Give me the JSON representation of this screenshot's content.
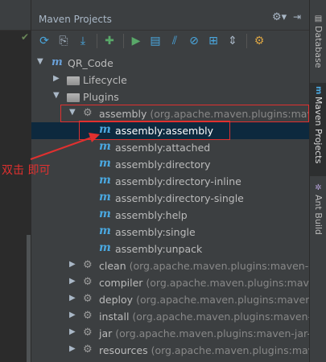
{
  "panel": {
    "title": "Maven Projects"
  },
  "header_icons": {
    "settings": "gear-icon",
    "hide": "hide-panel-icon"
  },
  "toolbar": {
    "buttons": [
      "refresh-icon",
      "reimport-icon",
      "download-icon",
      "add-icon",
      "run-icon",
      "execute-goal-icon",
      "toggle-offline-icon",
      "skip-tests-icon",
      "show-dependencies-icon",
      "collapse-all-icon",
      "settings-icon"
    ]
  },
  "tree": {
    "root": "QR_Code",
    "lifecycle": "Lifecycle",
    "plugins": "Plugins",
    "assembly": {
      "name": "assembly",
      "detail": "(org.apache.maven.plugins:maven-"
    },
    "assembly_goals": [
      "assembly:assembly",
      "assembly:attached",
      "assembly:directory",
      "assembly:directory-inline",
      "assembly:directory-single",
      "assembly:help",
      "assembly:single",
      "assembly:unpack"
    ],
    "plugins_list": [
      {
        "name": "clean",
        "detail": "(org.apache.maven.plugins:maven-clea"
      },
      {
        "name": "compiler",
        "detail": "(org.apache.maven.plugins:maven-c"
      },
      {
        "name": "deploy",
        "detail": "(org.apache.maven.plugins:maven-de"
      },
      {
        "name": "install",
        "detail": "(org.apache.maven.plugins:maven-inst"
      },
      {
        "name": "jar",
        "detail": "(org.apache.maven.plugins:maven-jar-plu"
      },
      {
        "name": "resources",
        "detail": "(org.apache.maven.plugins:maven-"
      }
    ]
  },
  "side_tabs": {
    "database": "Database",
    "maven": "Maven Projects",
    "ant": "Ant Build"
  },
  "annotation": {
    "text": "双击 即可",
    "color": "#e0302f"
  },
  "colors": {
    "selection": "#0d293e",
    "maven_icon": "#4aa8e0",
    "panel_bg": "#3c3f41"
  }
}
